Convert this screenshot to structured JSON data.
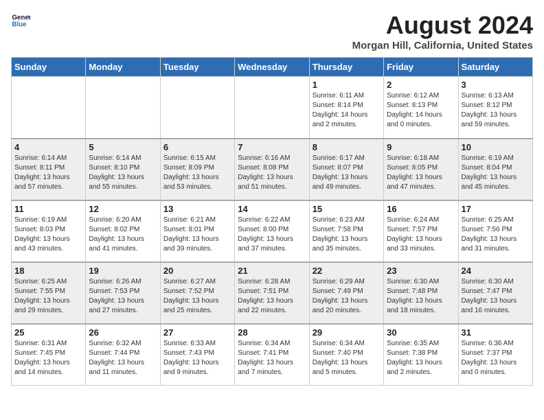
{
  "logo": {
    "line1": "General",
    "line2": "Blue"
  },
  "title": "August 2024",
  "subtitle": "Morgan Hill, California, United States",
  "days_of_week": [
    "Sunday",
    "Monday",
    "Tuesday",
    "Wednesday",
    "Thursday",
    "Friday",
    "Saturday"
  ],
  "weeks": [
    [
      {
        "day": "",
        "info": ""
      },
      {
        "day": "",
        "info": ""
      },
      {
        "day": "",
        "info": ""
      },
      {
        "day": "",
        "info": ""
      },
      {
        "day": "1",
        "info": "Sunrise: 6:11 AM\nSunset: 8:14 PM\nDaylight: 14 hours\nand 2 minutes."
      },
      {
        "day": "2",
        "info": "Sunrise: 6:12 AM\nSunset: 8:13 PM\nDaylight: 14 hours\nand 0 minutes."
      },
      {
        "day": "3",
        "info": "Sunrise: 6:13 AM\nSunset: 8:12 PM\nDaylight: 13 hours\nand 59 minutes."
      }
    ],
    [
      {
        "day": "4",
        "info": "Sunrise: 6:14 AM\nSunset: 8:11 PM\nDaylight: 13 hours\nand 57 minutes."
      },
      {
        "day": "5",
        "info": "Sunrise: 6:14 AM\nSunset: 8:10 PM\nDaylight: 13 hours\nand 55 minutes."
      },
      {
        "day": "6",
        "info": "Sunrise: 6:15 AM\nSunset: 8:09 PM\nDaylight: 13 hours\nand 53 minutes."
      },
      {
        "day": "7",
        "info": "Sunrise: 6:16 AM\nSunset: 8:08 PM\nDaylight: 13 hours\nand 51 minutes."
      },
      {
        "day": "8",
        "info": "Sunrise: 6:17 AM\nSunset: 8:07 PM\nDaylight: 13 hours\nand 49 minutes."
      },
      {
        "day": "9",
        "info": "Sunrise: 6:18 AM\nSunset: 8:05 PM\nDaylight: 13 hours\nand 47 minutes."
      },
      {
        "day": "10",
        "info": "Sunrise: 6:19 AM\nSunset: 8:04 PM\nDaylight: 13 hours\nand 45 minutes."
      }
    ],
    [
      {
        "day": "11",
        "info": "Sunrise: 6:19 AM\nSunset: 8:03 PM\nDaylight: 13 hours\nand 43 minutes."
      },
      {
        "day": "12",
        "info": "Sunrise: 6:20 AM\nSunset: 8:02 PM\nDaylight: 13 hours\nand 41 minutes."
      },
      {
        "day": "13",
        "info": "Sunrise: 6:21 AM\nSunset: 8:01 PM\nDaylight: 13 hours\nand 39 minutes."
      },
      {
        "day": "14",
        "info": "Sunrise: 6:22 AM\nSunset: 8:00 PM\nDaylight: 13 hours\nand 37 minutes."
      },
      {
        "day": "15",
        "info": "Sunrise: 6:23 AM\nSunset: 7:58 PM\nDaylight: 13 hours\nand 35 minutes."
      },
      {
        "day": "16",
        "info": "Sunrise: 6:24 AM\nSunset: 7:57 PM\nDaylight: 13 hours\nand 33 minutes."
      },
      {
        "day": "17",
        "info": "Sunrise: 6:25 AM\nSunset: 7:56 PM\nDaylight: 13 hours\nand 31 minutes."
      }
    ],
    [
      {
        "day": "18",
        "info": "Sunrise: 6:25 AM\nSunset: 7:55 PM\nDaylight: 13 hours\nand 29 minutes."
      },
      {
        "day": "19",
        "info": "Sunrise: 6:26 AM\nSunset: 7:53 PM\nDaylight: 13 hours\nand 27 minutes."
      },
      {
        "day": "20",
        "info": "Sunrise: 6:27 AM\nSunset: 7:52 PM\nDaylight: 13 hours\nand 25 minutes."
      },
      {
        "day": "21",
        "info": "Sunrise: 6:28 AM\nSunset: 7:51 PM\nDaylight: 13 hours\nand 22 minutes."
      },
      {
        "day": "22",
        "info": "Sunrise: 6:29 AM\nSunset: 7:49 PM\nDaylight: 13 hours\nand 20 minutes."
      },
      {
        "day": "23",
        "info": "Sunrise: 6:30 AM\nSunset: 7:48 PM\nDaylight: 13 hours\nand 18 minutes."
      },
      {
        "day": "24",
        "info": "Sunrise: 6:30 AM\nSunset: 7:47 PM\nDaylight: 13 hours\nand 16 minutes."
      }
    ],
    [
      {
        "day": "25",
        "info": "Sunrise: 6:31 AM\nSunset: 7:45 PM\nDaylight: 13 hours\nand 14 minutes."
      },
      {
        "day": "26",
        "info": "Sunrise: 6:32 AM\nSunset: 7:44 PM\nDaylight: 13 hours\nand 11 minutes."
      },
      {
        "day": "27",
        "info": "Sunrise: 6:33 AM\nSunset: 7:43 PM\nDaylight: 13 hours\nand 9 minutes."
      },
      {
        "day": "28",
        "info": "Sunrise: 6:34 AM\nSunset: 7:41 PM\nDaylight: 13 hours\nand 7 minutes."
      },
      {
        "day": "29",
        "info": "Sunrise: 6:34 AM\nSunset: 7:40 PM\nDaylight: 13 hours\nand 5 minutes."
      },
      {
        "day": "30",
        "info": "Sunrise: 6:35 AM\nSunset: 7:38 PM\nDaylight: 13 hours\nand 2 minutes."
      },
      {
        "day": "31",
        "info": "Sunrise: 6:36 AM\nSunset: 7:37 PM\nDaylight: 13 hours\nand 0 minutes."
      }
    ]
  ]
}
